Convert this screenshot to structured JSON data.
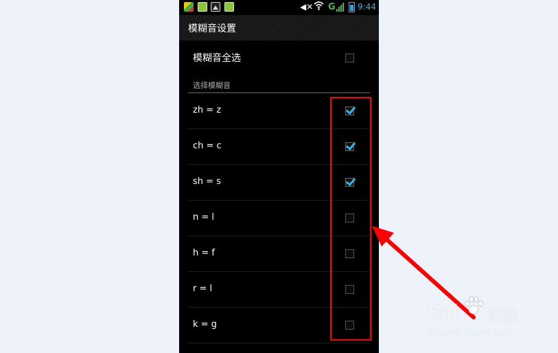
{
  "status_bar": {
    "time": "9:44",
    "network": "G",
    "icons": [
      "app-icon",
      "app-icon",
      "image-icon",
      "app-icon",
      "mute-icon",
      "wifi-icon",
      "signal-icon",
      "battery-icon"
    ]
  },
  "action_bar": {
    "title": "模糊音设置"
  },
  "select_all": {
    "label": "模糊音全选",
    "checked": false
  },
  "section": {
    "label": "选择模糊音"
  },
  "items": [
    {
      "label": "zh = z",
      "checked": true
    },
    {
      "label": "ch = c",
      "checked": true
    },
    {
      "label": "sh = s",
      "checked": true
    },
    {
      "label": "n = l",
      "checked": false
    },
    {
      "label": "h = f",
      "checked": false
    },
    {
      "label": "r = l",
      "checked": false
    },
    {
      "label": "k = g",
      "checked": false
    }
  ],
  "annotation": {
    "highlight_color": "#ff0000",
    "arrow_color": "#ff0000"
  },
  "watermark": {
    "logo": "Bai",
    "brand": "经验",
    "url": "jingyan.baidu.com"
  },
  "colors": {
    "accent": "#33b5e5",
    "background": "#000000",
    "page": "#edf2fb"
  }
}
